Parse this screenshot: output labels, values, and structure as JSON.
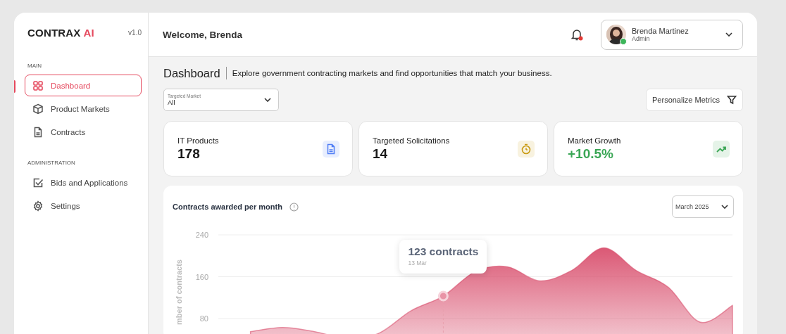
{
  "brand": {
    "name": "CONTRAX",
    "accent": "AI",
    "version": "v1.0"
  },
  "sidebar": {
    "sections": [
      {
        "title": "MAIN",
        "items": [
          {
            "label": "Dashboard",
            "selected": true
          },
          {
            "label": "Product Markets",
            "selected": false
          },
          {
            "label": "Contracts",
            "selected": false
          }
        ]
      },
      {
        "title": "ADMINISTRATION",
        "items": [
          {
            "label": "Bids and Applications",
            "selected": false
          },
          {
            "label": "Settings",
            "selected": false
          }
        ]
      }
    ]
  },
  "header": {
    "welcome": "Welcome, Brenda",
    "notifications_unread": true,
    "user": {
      "name": "Brenda Martinez",
      "role": "Admin",
      "online": true
    }
  },
  "page": {
    "title": "Dashboard",
    "subtitle": "Explore government contracting markets and find opportunities that match your business."
  },
  "filter": {
    "label": "Targeted Market",
    "value": "All"
  },
  "personalize_button": "Personalize Metrics",
  "metrics": [
    {
      "label": "IT Products",
      "value": "178",
      "kind": "count",
      "color": "#4f7df5"
    },
    {
      "label": "Targeted Solicitations",
      "value": "14",
      "kind": "count",
      "color": "#c99a12"
    },
    {
      "label": "Market Growth",
      "value": "+10.5%",
      "kind": "growth",
      "color": "#3aa655"
    }
  ],
  "chart": {
    "title": "Contracts awarded per month",
    "period": "March 2025",
    "tooltip": {
      "value": "123 contracts",
      "date": "13 Mar"
    },
    "ylabel": "mber of contracts",
    "yticks": [
      "240",
      "160",
      "80"
    ]
  }
}
